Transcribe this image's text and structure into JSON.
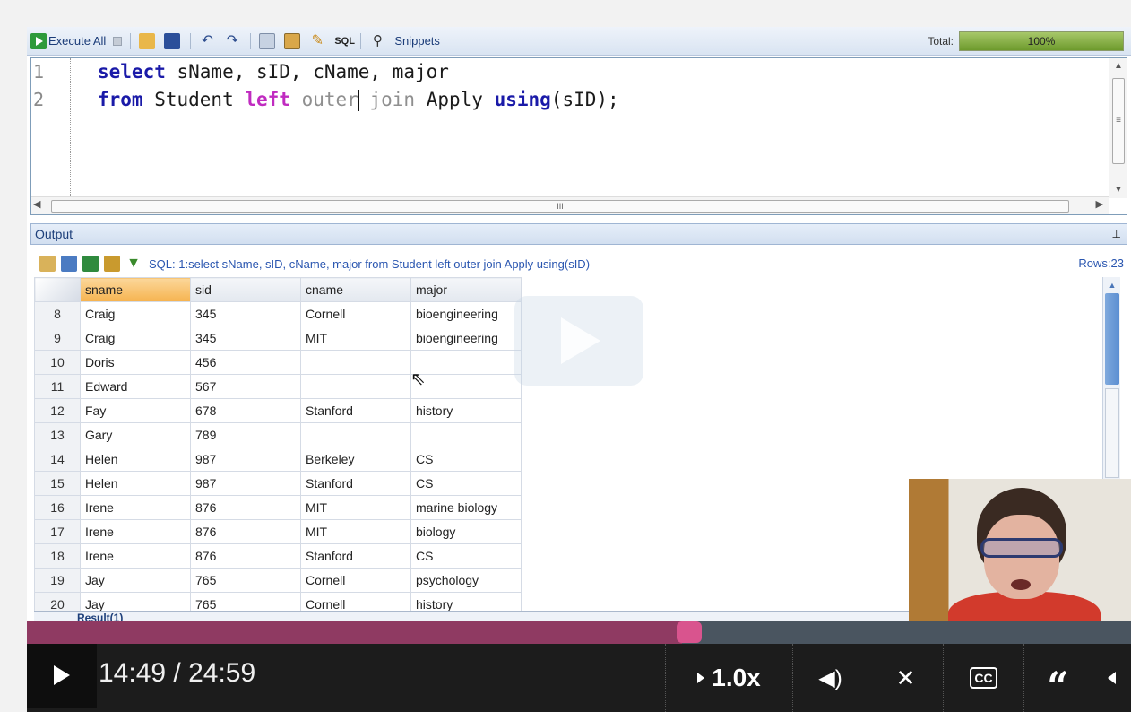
{
  "toolbar": {
    "execute_label": "Execute All",
    "snippets_label": "Snippets",
    "total_label": "Total:",
    "total_value": "100%",
    "total_fraction": 1.0
  },
  "editor": {
    "line_numbers": [
      "1",
      "2"
    ],
    "scroll_marker": "III"
  },
  "output": {
    "header": "Output",
    "sql_text": "SQL: 1:select sName, sID, cName, major  from Student left outer join Apply using(sID)",
    "rows_text": "Rows:23",
    "columns": [
      "sname",
      "sid",
      "cname",
      "major"
    ],
    "rows": [
      [
        "8",
        "Craig",
        "345",
        "Cornell",
        "bioengineering"
      ],
      [
        "9",
        "Craig",
        "345",
        "MIT",
        "bioengineering"
      ],
      [
        "10",
        "Doris",
        "456",
        "",
        ""
      ],
      [
        "11",
        "Edward",
        "567",
        "",
        ""
      ],
      [
        "12",
        "Fay",
        "678",
        "Stanford",
        "history"
      ],
      [
        "13",
        "Gary",
        "789",
        "",
        ""
      ],
      [
        "14",
        "Helen",
        "987",
        "Berkeley",
        "CS"
      ],
      [
        "15",
        "Helen",
        "987",
        "Stanford",
        "CS"
      ],
      [
        "16",
        "Irene",
        "876",
        "MIT",
        "marine biology"
      ],
      [
        "17",
        "Irene",
        "876",
        "MIT",
        "biology"
      ],
      [
        "18",
        "Irene",
        "876",
        "Stanford",
        "CS"
      ],
      [
        "19",
        "Jay",
        "765",
        "Cornell",
        "psychology"
      ],
      [
        "20",
        "Jay",
        "765",
        "Cornell",
        "history"
      ]
    ],
    "result_tab": "Result(1)"
  },
  "video": {
    "time": "14:49 / 24:59",
    "speed": "1.0x",
    "progress_fraction": 0.593,
    "cc_label": "CC",
    "transcript_glyph": "“"
  },
  "colors": {
    "progress_played": "#8f3a62",
    "progress_knob": "#d9548e",
    "sorted_header": "#f6b34f"
  }
}
